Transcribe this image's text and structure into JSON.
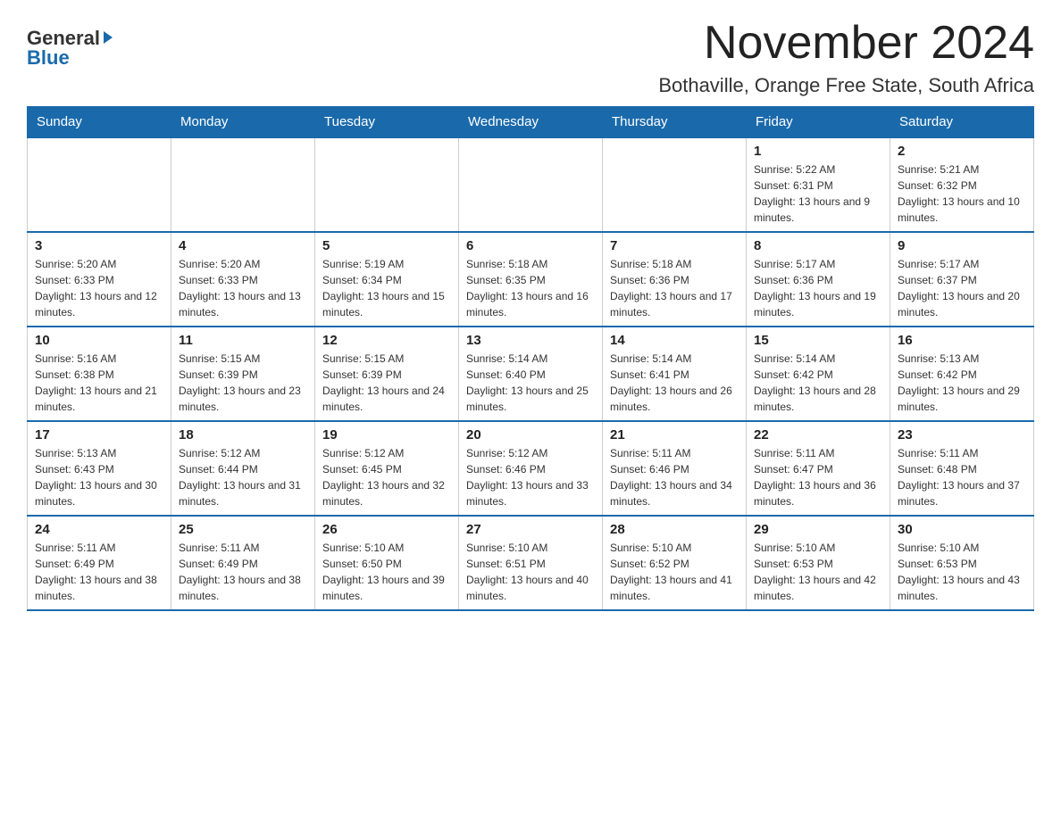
{
  "logo": {
    "general": "General",
    "blue": "Blue"
  },
  "title": {
    "month_year": "November 2024",
    "location": "Bothaville, Orange Free State, South Africa"
  },
  "headers": [
    "Sunday",
    "Monday",
    "Tuesday",
    "Wednesday",
    "Thursday",
    "Friday",
    "Saturday"
  ],
  "weeks": [
    [
      {
        "day": "",
        "info": ""
      },
      {
        "day": "",
        "info": ""
      },
      {
        "day": "",
        "info": ""
      },
      {
        "day": "",
        "info": ""
      },
      {
        "day": "",
        "info": ""
      },
      {
        "day": "1",
        "info": "Sunrise: 5:22 AM\nSunset: 6:31 PM\nDaylight: 13 hours and 9 minutes."
      },
      {
        "day": "2",
        "info": "Sunrise: 5:21 AM\nSunset: 6:32 PM\nDaylight: 13 hours and 10 minutes."
      }
    ],
    [
      {
        "day": "3",
        "info": "Sunrise: 5:20 AM\nSunset: 6:33 PM\nDaylight: 13 hours and 12 minutes."
      },
      {
        "day": "4",
        "info": "Sunrise: 5:20 AM\nSunset: 6:33 PM\nDaylight: 13 hours and 13 minutes."
      },
      {
        "day": "5",
        "info": "Sunrise: 5:19 AM\nSunset: 6:34 PM\nDaylight: 13 hours and 15 minutes."
      },
      {
        "day": "6",
        "info": "Sunrise: 5:18 AM\nSunset: 6:35 PM\nDaylight: 13 hours and 16 minutes."
      },
      {
        "day": "7",
        "info": "Sunrise: 5:18 AM\nSunset: 6:36 PM\nDaylight: 13 hours and 17 minutes."
      },
      {
        "day": "8",
        "info": "Sunrise: 5:17 AM\nSunset: 6:36 PM\nDaylight: 13 hours and 19 minutes."
      },
      {
        "day": "9",
        "info": "Sunrise: 5:17 AM\nSunset: 6:37 PM\nDaylight: 13 hours and 20 minutes."
      }
    ],
    [
      {
        "day": "10",
        "info": "Sunrise: 5:16 AM\nSunset: 6:38 PM\nDaylight: 13 hours and 21 minutes."
      },
      {
        "day": "11",
        "info": "Sunrise: 5:15 AM\nSunset: 6:39 PM\nDaylight: 13 hours and 23 minutes."
      },
      {
        "day": "12",
        "info": "Sunrise: 5:15 AM\nSunset: 6:39 PM\nDaylight: 13 hours and 24 minutes."
      },
      {
        "day": "13",
        "info": "Sunrise: 5:14 AM\nSunset: 6:40 PM\nDaylight: 13 hours and 25 minutes."
      },
      {
        "day": "14",
        "info": "Sunrise: 5:14 AM\nSunset: 6:41 PM\nDaylight: 13 hours and 26 minutes."
      },
      {
        "day": "15",
        "info": "Sunrise: 5:14 AM\nSunset: 6:42 PM\nDaylight: 13 hours and 28 minutes."
      },
      {
        "day": "16",
        "info": "Sunrise: 5:13 AM\nSunset: 6:42 PM\nDaylight: 13 hours and 29 minutes."
      }
    ],
    [
      {
        "day": "17",
        "info": "Sunrise: 5:13 AM\nSunset: 6:43 PM\nDaylight: 13 hours and 30 minutes."
      },
      {
        "day": "18",
        "info": "Sunrise: 5:12 AM\nSunset: 6:44 PM\nDaylight: 13 hours and 31 minutes."
      },
      {
        "day": "19",
        "info": "Sunrise: 5:12 AM\nSunset: 6:45 PM\nDaylight: 13 hours and 32 minutes."
      },
      {
        "day": "20",
        "info": "Sunrise: 5:12 AM\nSunset: 6:46 PM\nDaylight: 13 hours and 33 minutes."
      },
      {
        "day": "21",
        "info": "Sunrise: 5:11 AM\nSunset: 6:46 PM\nDaylight: 13 hours and 34 minutes."
      },
      {
        "day": "22",
        "info": "Sunrise: 5:11 AM\nSunset: 6:47 PM\nDaylight: 13 hours and 36 minutes."
      },
      {
        "day": "23",
        "info": "Sunrise: 5:11 AM\nSunset: 6:48 PM\nDaylight: 13 hours and 37 minutes."
      }
    ],
    [
      {
        "day": "24",
        "info": "Sunrise: 5:11 AM\nSunset: 6:49 PM\nDaylight: 13 hours and 38 minutes."
      },
      {
        "day": "25",
        "info": "Sunrise: 5:11 AM\nSunset: 6:49 PM\nDaylight: 13 hours and 38 minutes."
      },
      {
        "day": "26",
        "info": "Sunrise: 5:10 AM\nSunset: 6:50 PM\nDaylight: 13 hours and 39 minutes."
      },
      {
        "day": "27",
        "info": "Sunrise: 5:10 AM\nSunset: 6:51 PM\nDaylight: 13 hours and 40 minutes."
      },
      {
        "day": "28",
        "info": "Sunrise: 5:10 AM\nSunset: 6:52 PM\nDaylight: 13 hours and 41 minutes."
      },
      {
        "day": "29",
        "info": "Sunrise: 5:10 AM\nSunset: 6:53 PM\nDaylight: 13 hours and 42 minutes."
      },
      {
        "day": "30",
        "info": "Sunrise: 5:10 AM\nSunset: 6:53 PM\nDaylight: 13 hours and 43 minutes."
      }
    ]
  ]
}
